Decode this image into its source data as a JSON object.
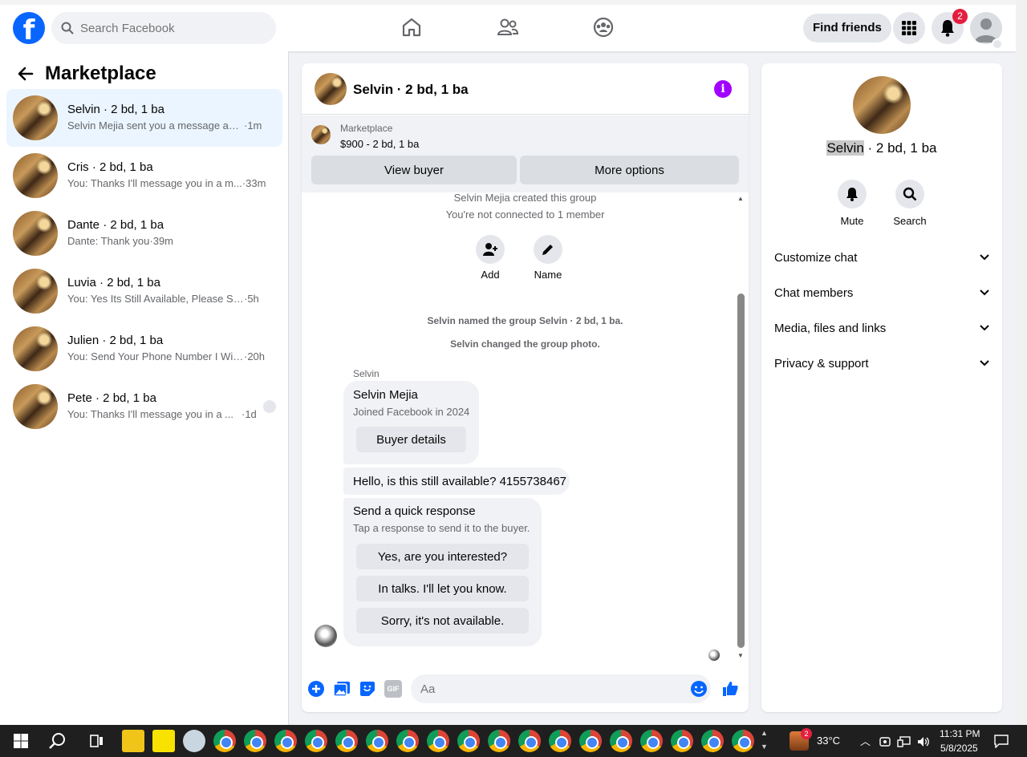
{
  "nav": {
    "search_placeholder": "Search Facebook",
    "find_friends": "Find friends",
    "notification_count": "2"
  },
  "sidebar": {
    "title": "Marketplace",
    "conversations": [
      {
        "name": "Selvin · 2 bd, 1 ba",
        "preview": "Selvin Mejia sent you a message abo...",
        "time": "·1m",
        "active": true
      },
      {
        "name": "Cris · 2 bd, 1 ba",
        "preview": "You: Thanks I'll message you in a m...",
        "time": "·33m"
      },
      {
        "name": "Dante · 2 bd, 1 ba",
        "preview": "Dante: Thank you",
        "time": "·39m"
      },
      {
        "name": "Luvia · 2 bd, 1 ba",
        "preview": "You: Yes Its Still Available, Please Send...",
        "time": "·5h"
      },
      {
        "name": "Julien · 2 bd, 1 ba",
        "preview": "You: Send Your Phone Number I Will...",
        "time": "·20h"
      },
      {
        "name": "Pete · 2 bd, 1 ba",
        "preview": "You: Thanks I'll message you in a ...",
        "time": "·1d"
      }
    ]
  },
  "chat": {
    "title": "Selvin · 2 bd, 1 ba",
    "marketplace_label": "Marketplace",
    "listing": "$900 - 2 bd, 1 ba",
    "view_buyer": "View buyer",
    "more_options": "More options",
    "created": "Selvin Mejia created this group",
    "not_connected": "You're not connected to 1 member",
    "add_label": "Add",
    "name_label": "Name",
    "named_event": "Selvin named the group Selvin · 2 bd, 1 ba.",
    "photo_event": "Selvin changed the group photo.",
    "sender": "Selvin",
    "profile_name": "Selvin Mejia",
    "profile_joined": "Joined Facebook in 2024",
    "buyer_details": "Buyer details",
    "message": "Hello, is this still available? 4155738467",
    "quick_title": "Send a quick response",
    "quick_sub": "Tap a response to send it to the buyer.",
    "quick_1": "Yes, are you interested?",
    "quick_2": "In talks. I'll let you know.",
    "quick_3": "Sorry, it's not available.",
    "input_placeholder": "Aa",
    "gif_label": "GIF"
  },
  "info": {
    "title_highlight": "Selvin",
    "title_rest": " · 2 bd, 1 ba",
    "mute": "Mute",
    "search": "Search",
    "sections": [
      "Customize chat",
      "Chat members",
      "Media, files and links",
      "Privacy & support"
    ]
  },
  "taskbar": {
    "temperature": "33°C",
    "time": "11:31 PM",
    "date": "5/8/2025",
    "weather_badge": "2"
  },
  "colors": {
    "facebook_blue": "#0866ff",
    "messenger_purple": "#a100ff",
    "active_bg": "#ebf5ff"
  }
}
